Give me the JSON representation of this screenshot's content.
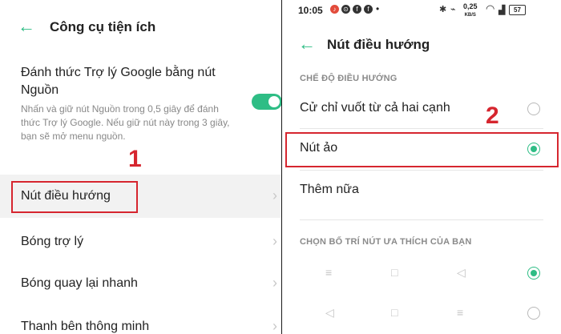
{
  "left": {
    "header": {
      "title": "Công cụ tiện ích"
    },
    "google_assistant": {
      "title": "Đánh thức Trợ lý Google bằng nút Nguồn",
      "description": "Nhấn và giữ nút Nguồn trong 0,5 giây để đánh thức Trợ lý Google. Nếu giữ nút này trong 3 giây, bạn sẽ mở menu nguồn.",
      "toggle_on": true
    },
    "badge": "1",
    "items": [
      {
        "label": "Nút điều hướng"
      },
      {
        "label": "Bóng trợ lý"
      },
      {
        "label": "Bóng quay lại nhanh"
      },
      {
        "label": "Thanh bên thông minh"
      }
    ]
  },
  "right": {
    "status_bar": {
      "time": "10:05",
      "net_speed": "0,25",
      "net_unit": "KB/S",
      "battery": "57"
    },
    "header": {
      "title": "Nút điều hướng"
    },
    "section_mode": "CHẾ ĐỘ ĐIỀU HƯỚNG",
    "badge": "2",
    "mode_options": [
      {
        "label": "Cử chỉ vuốt từ cả hai cạnh",
        "selected": false
      },
      {
        "label": "Nút ảo",
        "selected": true
      },
      {
        "label": "Thêm nữa"
      }
    ],
    "section_layout": "CHỌN BỐ TRÍ NÚT ƯA THÍCH CỦA BẠN",
    "layouts": [
      {
        "buttons": [
          "≡",
          "□",
          "◁"
        ],
        "selected": true
      },
      {
        "buttons": [
          "◁",
          "□",
          "≡"
        ],
        "selected": false
      }
    ]
  },
  "accent_color": "#2ebd85",
  "highlight_color": "#d6262f"
}
